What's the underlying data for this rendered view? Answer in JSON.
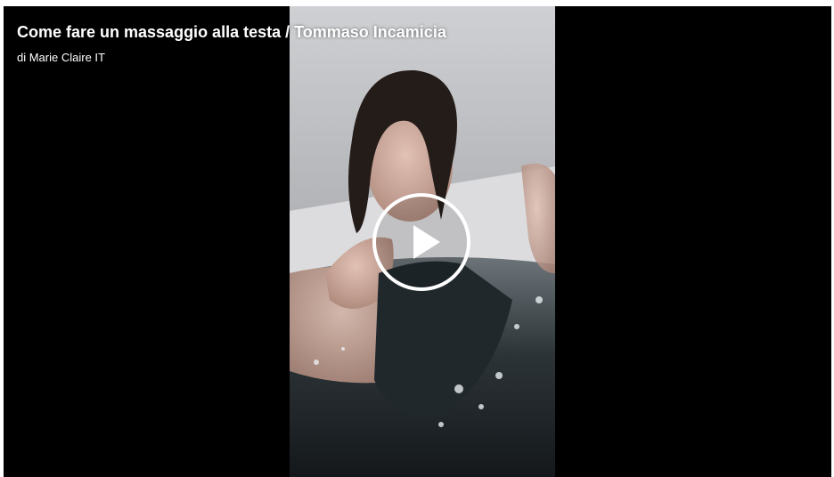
{
  "video": {
    "title": "Come fare un massaggio alla testa / Tommaso Incamicia",
    "byline": "di Marie Claire IT",
    "thumbnail_subject": "woman-in-bathtub",
    "play_icon": "play-icon"
  },
  "colors": {
    "player_background": "#000000",
    "text": "#ffffff",
    "play_button_outline": "#ffffff"
  }
}
